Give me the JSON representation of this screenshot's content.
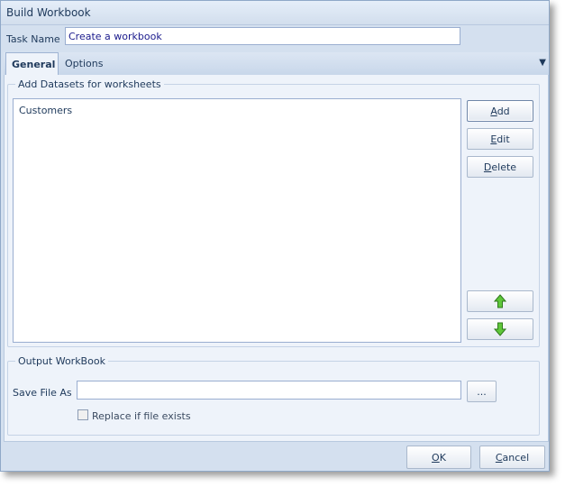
{
  "window": {
    "title": "Build Workbook"
  },
  "task": {
    "label": "Task Name",
    "value": "Create a workbook"
  },
  "tabs": [
    {
      "label": "General",
      "active": true
    },
    {
      "label": "Options",
      "active": false
    }
  ],
  "datasets": {
    "group_title": "Add Datasets for worksheets",
    "items": [
      "Customers"
    ],
    "buttons": {
      "add_pre": "",
      "add_key": "A",
      "add_post": "dd",
      "edit_pre": "",
      "edit_key": "E",
      "edit_post": "dit",
      "delete_pre": "",
      "delete_key": "D",
      "delete_post": "elete"
    }
  },
  "output": {
    "group_title": "Output WorkBook",
    "save_label": "Save File As",
    "save_value": "",
    "browse_label": "...",
    "replace_label": "Replace if file exists",
    "replace_checked": false
  },
  "footer": {
    "ok_key": "O",
    "ok_post": "K",
    "cancel_key": "C",
    "cancel_post": "ancel"
  },
  "colors": {
    "arrow_fill": "#5fc73a",
    "arrow_stroke": "#2f7a1c"
  }
}
